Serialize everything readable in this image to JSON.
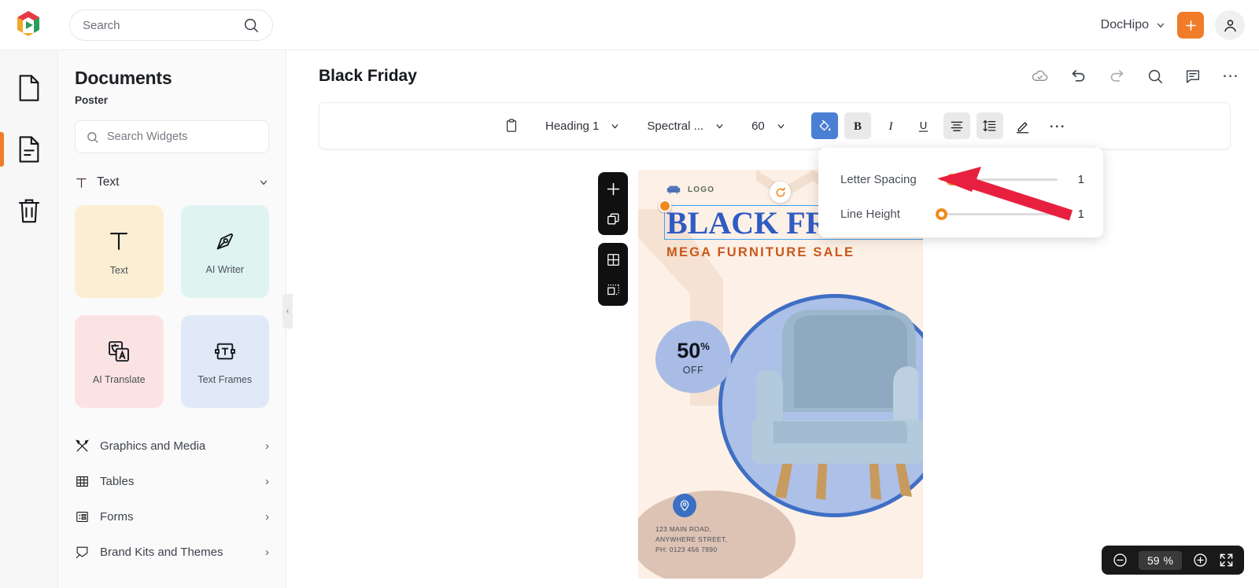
{
  "topbar": {
    "brand_icon": "dochipo-logo-icon",
    "search": {
      "placeholder": "Search",
      "value": "",
      "icon": "search-icon"
    },
    "workspace": {
      "label": "DocHipo",
      "icon": "chevron-down-icon"
    },
    "create_button": {
      "label": "+",
      "icon": "plus-icon",
      "color": "#f07c2a"
    },
    "account": {
      "icon": "user-avatar-icon"
    }
  },
  "rail": {
    "items": [
      {
        "name": "documents",
        "icon": "page-icon",
        "active": false
      },
      {
        "name": "templates",
        "icon": "document-lines-icon",
        "active": true
      },
      {
        "name": "trash",
        "icon": "trash-icon",
        "active": false
      }
    ]
  },
  "panel": {
    "title": "Documents",
    "subtitle": "Poster",
    "search": {
      "placeholder": "Search Widgets",
      "value": "",
      "icon": "search-icon"
    },
    "section": {
      "label": "Text",
      "icon": "text-t-icon",
      "toggle_icon": "chevron-down-icon"
    },
    "cards": [
      {
        "label": "Text",
        "icon": "text-t-icon",
        "bg": "#fbeed2"
      },
      {
        "label": "AI Writer",
        "icon": "pen-nib-icon",
        "bg": "#dff3f1"
      },
      {
        "label": "AI Translate",
        "icon": "translate-icon",
        "bg": "#fbe3e4"
      },
      {
        "label": "Text Frames",
        "icon": "text-frame-icon",
        "bg": "#e0e9f7"
      }
    ],
    "nav": [
      {
        "label": "Graphics and Media",
        "icon": "graphics-media-icon",
        "chevron": "›"
      },
      {
        "label": "Tables",
        "icon": "table-grid-icon",
        "chevron": "›"
      },
      {
        "label": "Forms",
        "icon": "form-icon",
        "chevron": "›"
      },
      {
        "label": "Brand Kits and Themes",
        "icon": "brand-kit-icon",
        "chevron": "›"
      }
    ],
    "collapse": {
      "icon": "chevron-left-icon",
      "glyph": "‹"
    }
  },
  "editor": {
    "doc_title": "Black Friday",
    "actions": [
      {
        "name": "cloud-saved",
        "icon": "cloud-check-icon"
      },
      {
        "name": "undo",
        "icon": "undo-arrow-icon"
      },
      {
        "name": "redo",
        "icon": "redo-arrow-icon"
      },
      {
        "name": "search",
        "icon": "search-icon"
      },
      {
        "name": "comments",
        "icon": "comment-icon"
      },
      {
        "name": "more-options",
        "icon": "ellipsis-icon",
        "glyph": "⋯"
      }
    ]
  },
  "toolbar": {
    "clipboard_icon": "clipboard-icon",
    "style_select": {
      "value": "Heading 1",
      "icon": "chevron-down-icon"
    },
    "font_select": {
      "value": "Spectral ...",
      "icon": "chevron-down-icon"
    },
    "size_select": {
      "value": "60",
      "icon": "chevron-down-icon"
    },
    "buttons": [
      {
        "name": "fill-color",
        "icon": "paint-bucket-icon",
        "active": true,
        "state": "accent"
      },
      {
        "name": "bold",
        "icon": "bold-icon",
        "label": "B",
        "state": "soft"
      },
      {
        "name": "italic",
        "icon": "italic-icon",
        "label": "I",
        "state": "none"
      },
      {
        "name": "underline",
        "icon": "underline-icon",
        "label": "U",
        "state": "none"
      },
      {
        "name": "align",
        "icon": "align-center-icon",
        "state": "soft"
      },
      {
        "name": "line-spacing",
        "icon": "line-spacing-icon",
        "state": "soft"
      },
      {
        "name": "highlighter",
        "icon": "highlighter-pen-icon",
        "state": "none"
      }
    ],
    "more": {
      "glyph": "⋯",
      "icon": "ellipsis-icon"
    }
  },
  "spacing_popup": {
    "rows": [
      {
        "label": "Letter Spacing",
        "value": "1",
        "fill_percent": 11,
        "thumb_percent": 11
      },
      {
        "label": "Line Height",
        "value": "1",
        "fill_percent": 0,
        "thumb_percent": 0
      }
    ]
  },
  "canvas_tools": {
    "groups": [
      [
        {
          "name": "add-page",
          "icon": "plus-icon"
        },
        {
          "name": "duplicate-page",
          "icon": "copy-icon"
        }
      ],
      [
        {
          "name": "grid-view",
          "icon": "grid-icon"
        },
        {
          "name": "position-snap",
          "icon": "position-icon"
        }
      ]
    ]
  },
  "poster": {
    "logo_text": "LOGO",
    "logo_icon": "sofa-icon",
    "headline": "BLACK FRIDAY",
    "subhead": "MEGA FURNITURE SALE",
    "badge": {
      "number": "50",
      "percent": "%",
      "caption": "OFF"
    },
    "address": {
      "pin_icon": "location-pin-icon",
      "lines": [
        "123 MAIN ROAD,",
        "ANYWHERE STREET,",
        "PH: 0123 456 7890"
      ]
    },
    "rotate_handle_icon": "rotate-icon",
    "colors": {
      "bg": "#fdf0e6",
      "headline": "#2f5bc4",
      "subhead": "#c8591b",
      "circle": "#adc0e8"
    }
  },
  "zoom": {
    "out_icon": "zoom-out-icon",
    "value": "59",
    "unit": "%",
    "in_icon": "zoom-in-icon",
    "fullscreen_icon": "fullscreen-icon"
  }
}
